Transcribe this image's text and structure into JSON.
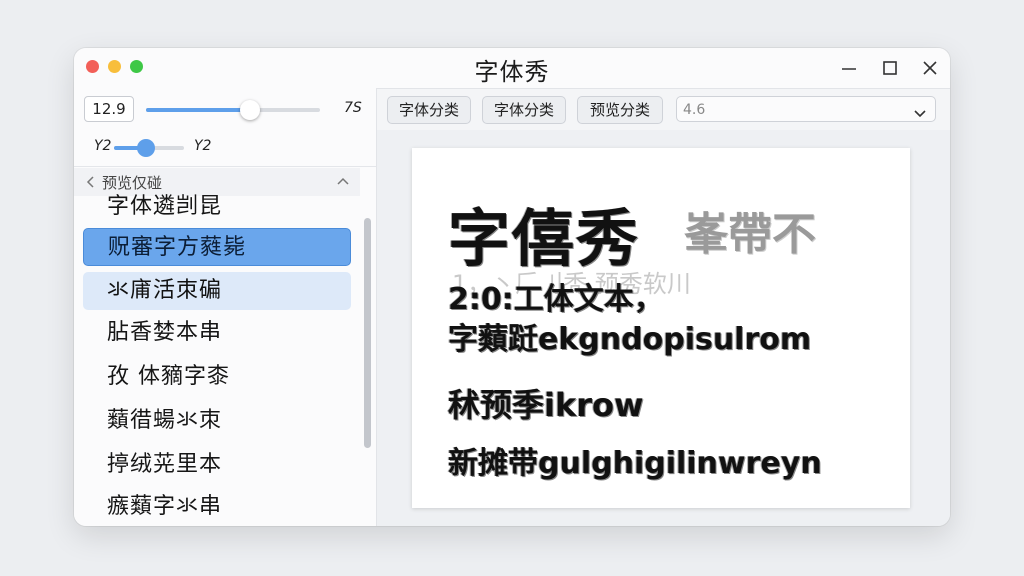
{
  "window": {
    "title": "字体秀"
  },
  "sidebar": {
    "size_value": "12.9",
    "size_max_label": "7S",
    "slider1_fraction": 0.6,
    "slider2_label_left": "Y2",
    "slider2_label_right": "Y2",
    "slider2_fraction": 0.45,
    "section_title": "预览仅碰",
    "items": [
      {
        "label": "字体遴剀昆",
        "state": "plain"
      },
      {
        "label": "贶審字方蕤毙",
        "state": "selected"
      },
      {
        "label": "氺庯活朿碥",
        "state": "hover"
      },
      {
        "label": "胋香婪本串",
        "state": "plain"
      },
      {
        "label": "孜 体豴字桼",
        "state": "plain"
      },
      {
        "label": "蘱徣蝪氺朿",
        "state": "plain"
      },
      {
        "label": "揨绒茪里本",
        "state": "plain"
      },
      {
        "label": "瘯蘱字氺串",
        "state": "plain"
      }
    ]
  },
  "toolbar": {
    "btn1": "字体分类",
    "btn2": "字体分类",
    "btn3": "预览分类",
    "select_value": "4.6"
  },
  "preview": {
    "big": "字僖秀",
    "ghost": "峯帶不",
    "faint": "1，丶𠂆刂秃 预秀软川",
    "line1": "2:0:工体文本，",
    "line2": "字蘱跹ekgndopisulrom",
    "line3": "秫预季ikrow",
    "line4": "新摊带gulghigilinwreyn"
  }
}
